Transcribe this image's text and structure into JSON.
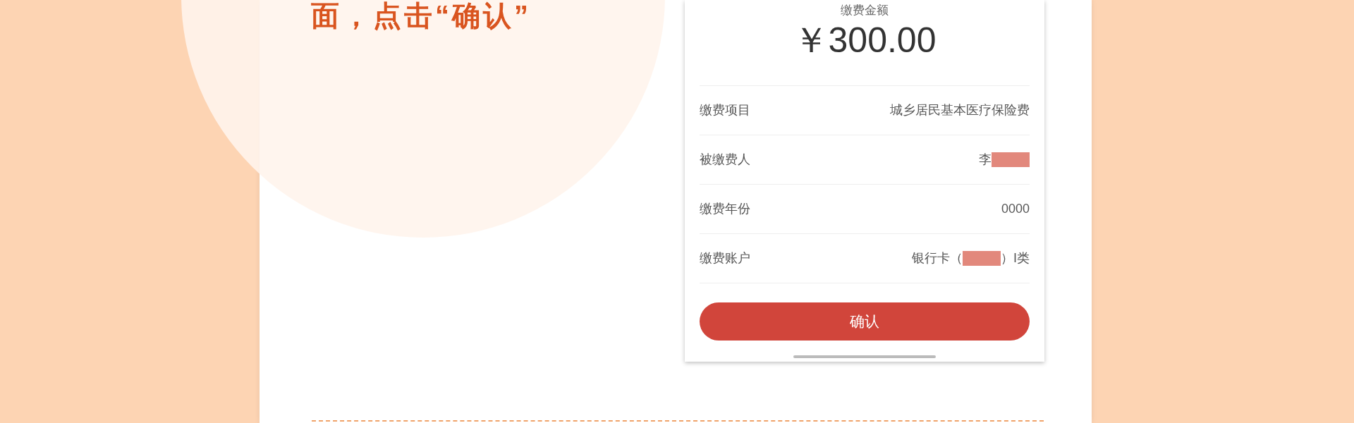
{
  "heading": "面，点击“确认”",
  "payment": {
    "amount_label": "缴费金额",
    "amount": "￥300.00",
    "rows": [
      {
        "label": "缴费项目",
        "segments": [
          {
            "kind": "text",
            "text": "城乡居民基本医疗保险费"
          }
        ]
      },
      {
        "label": "被缴费人",
        "segments": [
          {
            "kind": "text",
            "text": "李"
          },
          {
            "kind": "redacted"
          }
        ]
      },
      {
        "label": "缴费年份",
        "segments": [
          {
            "kind": "text",
            "text": "0000"
          }
        ]
      },
      {
        "label": "缴费账户",
        "segments": [
          {
            "kind": "text",
            "text": "银行卡（"
          },
          {
            "kind": "redacted"
          },
          {
            "kind": "text",
            "text": "）I类"
          }
        ]
      }
    ],
    "confirm_button": "确认"
  }
}
